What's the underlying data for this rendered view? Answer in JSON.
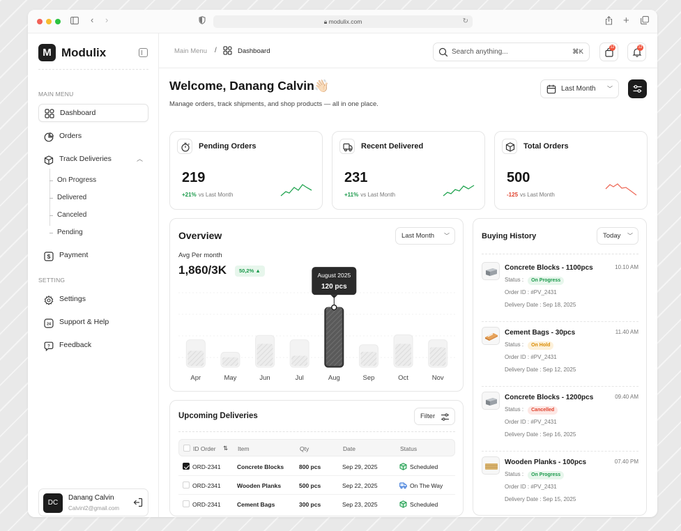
{
  "browser": {
    "url": "modulix.com",
    "dot_colors": [
      "#f26157",
      "#f7bd2f",
      "#2cc340"
    ]
  },
  "sidebar": {
    "brand_letter": "M",
    "brand_name": "Modulix",
    "main_menu_label": "MAIN MENU",
    "items": [
      {
        "label": "Dashboard"
      },
      {
        "label": "Orders"
      },
      {
        "label": "Track Deliveries"
      }
    ],
    "sub_items": [
      {
        "label": "On Progress"
      },
      {
        "label": "Delivered"
      },
      {
        "label": "Canceled"
      },
      {
        "label": "Pending"
      }
    ],
    "payment_label": "Payment",
    "setting_label": "SETTING",
    "settings_items": [
      {
        "label": "Settings"
      },
      {
        "label": "Support & Help"
      },
      {
        "label": "Feedback"
      }
    ],
    "user": {
      "initials": "DC",
      "name": "Danang Calvin",
      "email": "Calvinl2@gmail.com"
    }
  },
  "header": {
    "breadcrumb_root": "Main Menu",
    "breadcrumb_sep": "/",
    "breadcrumb_current": "Dashboard",
    "search_placeholder": "Search anything...",
    "search_shortcut": "⌘K",
    "cart_badge": "12",
    "notif_badge": "12"
  },
  "welcome": {
    "title": "Welcome, Danang Calvin👋🏻",
    "subtitle": "Manage orders, track shipments, and shop products — all in one place.",
    "date_filter": "Last Month"
  },
  "stats": [
    {
      "title": "Pending Orders",
      "value": "219",
      "delta": "+21%",
      "delta_label": "vs Last Month",
      "trend": "up"
    },
    {
      "title": "Recent Delivered",
      "value": "231",
      "delta": "+11%",
      "delta_label": "vs Last Month",
      "trend": "up"
    },
    {
      "title": "Total Orders",
      "value": "500",
      "delta": "-125",
      "delta_label": "vs Last Month",
      "trend": "down"
    }
  ],
  "overview": {
    "title": "Overview",
    "filter": "Last Month",
    "avg_label": "Avg Per month",
    "avg_value": "1,860/3K",
    "avg_change": "50,2% ▲",
    "tooltip_month": "August 2025",
    "tooltip_value": "120 pcs"
  },
  "chart_data": {
    "type": "bar",
    "categories": [
      "Apr",
      "May",
      "Jun",
      "Jul",
      "Aug",
      "Sep",
      "Oct",
      "Nov"
    ],
    "series": [
      {
        "values": [
          55,
          30,
          64,
          55,
          120,
          45,
          65,
          55
        ]
      },
      {
        "values": [
          33,
          20,
          47,
          23,
          120,
          31,
          47,
          40
        ]
      }
    ],
    "highlight_index": 4,
    "ylim": [
      0,
      130
    ],
    "grid": true,
    "accent_color": "#4a4a4a"
  },
  "deliveries": {
    "title": "Upcoming Deliveries",
    "filter_label": "Filter",
    "columns": [
      "ID Order",
      "Item",
      "Qty",
      "Date",
      "Status"
    ],
    "rows": [
      {
        "id": "ORD-2341",
        "item": "Concrete Blocks",
        "qty": "800 pcs",
        "date": "Sep 29, 2025",
        "status": "Scheduled",
        "checked": true
      },
      {
        "id": "ORD-2341",
        "item": "Wooden Planks",
        "qty": "500 pcs",
        "date": "Sep 22, 2025",
        "status": "On The Way",
        "checked": false
      },
      {
        "id": "ORD-2341",
        "item": "Cement Bags",
        "qty": "300 pcs",
        "date": "Sep 23, 2025",
        "status": "Scheduled",
        "checked": false
      }
    ]
  },
  "buying_history": {
    "title": "Buying History",
    "filter": "Today",
    "status_label": "Status :",
    "items": [
      {
        "name": "Concrete Blocks - 1100pcs",
        "time": "10.10 AM",
        "status": "On Progress",
        "order_id": "Order ID : #PV_2431",
        "delivery": "Delivery Date : Sep 18, 2025",
        "status_color": "#1b9a4b",
        "status_bg": "#e7f6ec"
      },
      {
        "name": "Cement Bags - 30pcs",
        "time": "11.40 AM",
        "status": "On Hold",
        "order_id": "Order ID : #PV_2431",
        "delivery": "Delivery Date : Sep 12, 2025",
        "status_color": "#d98a00",
        "status_bg": "#fdf1da"
      },
      {
        "name": "Concrete Blocks - 1200pcs",
        "time": "09.40 AM",
        "status": "Cancelled",
        "order_id": "Order ID : #PV_2431",
        "delivery": "Delivery Date : Sep 16, 2025",
        "status_color": "#e0412c",
        "status_bg": "#fde7e4"
      },
      {
        "name": "Wooden Planks - 100pcs",
        "time": "07.40 PM",
        "status": "On Progress",
        "order_id": "Order ID : #PV_2431",
        "delivery": "Delivery Date : Sep 15, 2025",
        "status_color": "#1b9a4b",
        "status_bg": "#e7f6ec"
      }
    ]
  }
}
